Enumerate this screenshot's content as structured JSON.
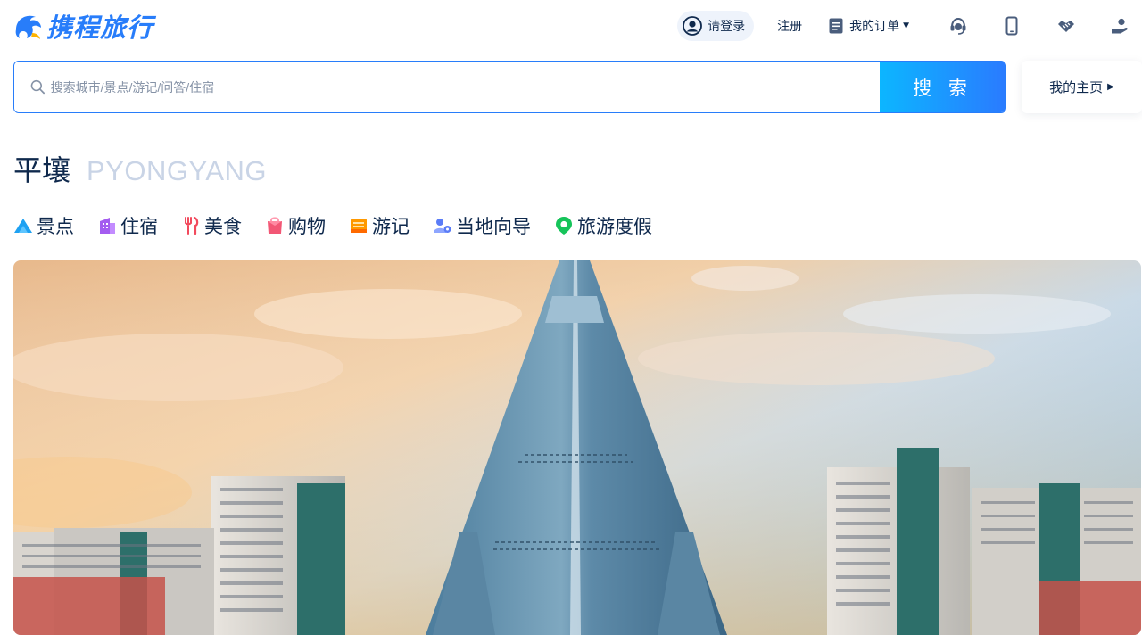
{
  "brand": {
    "name": "携程旅行",
    "color": "#287dfa"
  },
  "header": {
    "login_label": "请登录",
    "register_label": "注册",
    "orders_label": "我的订单",
    "icons": [
      "headset-icon",
      "mobile-app-icon",
      "handshake-icon",
      "user-service-icon"
    ]
  },
  "search": {
    "placeholder": "搜索城市/景点/游记/问答/住宿",
    "button_label": "搜 索",
    "home_label": "我的主页"
  },
  "city": {
    "name_cn": "平壤",
    "name_en": "PYONGYANG"
  },
  "categories": [
    {
      "label": "景点",
      "icon": "attraction-icon",
      "color": "#1ea1f2"
    },
    {
      "label": "住宿",
      "icon": "hotel-icon",
      "color": "#a45cf0"
    },
    {
      "label": "美食",
      "icon": "food-icon",
      "color": "#f24a5d"
    },
    {
      "label": "购物",
      "icon": "shopping-icon",
      "color": "#f25775"
    },
    {
      "label": "游记",
      "icon": "travelogue-icon",
      "color": "#ff9900"
    },
    {
      "label": "当地向导",
      "icon": "local-guide-icon",
      "color": "#5a7cf7"
    },
    {
      "label": "旅游度假",
      "icon": "vacation-icon",
      "color": "#16c45a"
    }
  ],
  "accent": {
    "search_gradient": [
      "#0cb6ff",
      "#2a7bff"
    ]
  }
}
